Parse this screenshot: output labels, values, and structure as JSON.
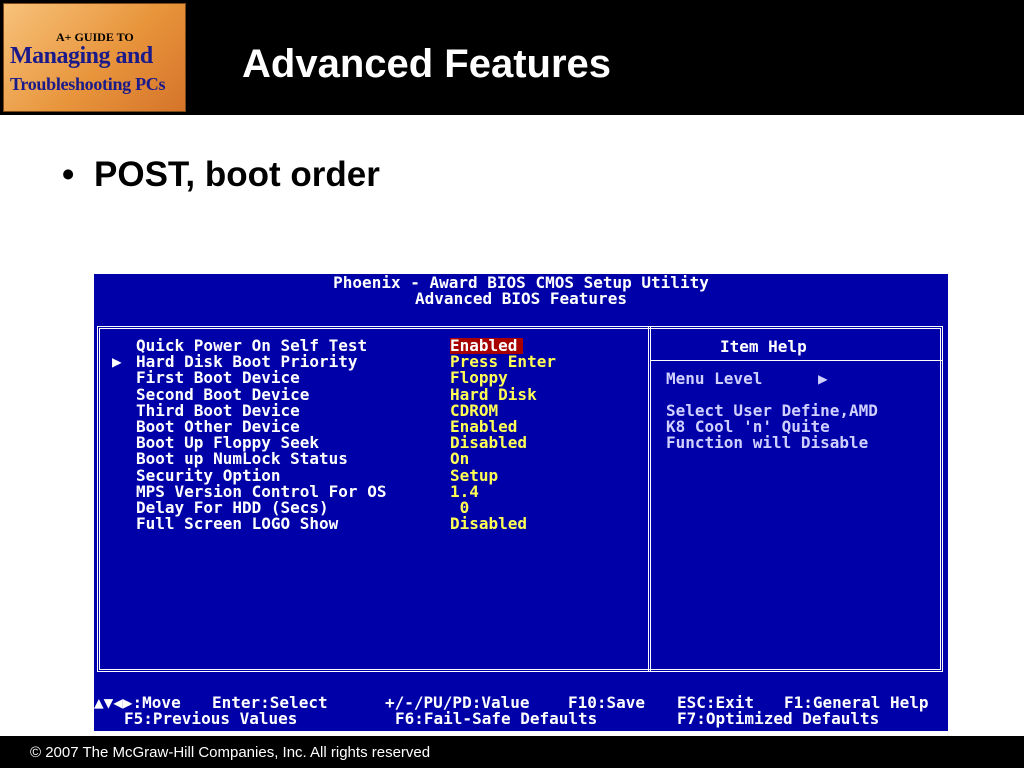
{
  "header": {
    "logo_line1": "A+ GUIDE TO",
    "logo_line2": "Managing and",
    "logo_line3": "Troubleshooting PCs",
    "title": "Advanced Features"
  },
  "bullet": {
    "glyph": "•",
    "text": "POST, boot order"
  },
  "bios": {
    "title_line1": "Phoenix - Award BIOS CMOS Setup Utility",
    "title_line2": "Advanced BIOS Features",
    "items": [
      {
        "label": "Quick Power On Self Test",
        "value": "Enabled",
        "arrow": "",
        "selected": true
      },
      {
        "label": "Hard Disk Boot Priority",
        "value": "Press Enter",
        "arrow": "▶",
        "selected": false
      },
      {
        "label": "First Boot Device",
        "value": "Floppy",
        "arrow": "",
        "selected": false
      },
      {
        "label": "Second Boot Device",
        "value": "Hard Disk",
        "arrow": "",
        "selected": false
      },
      {
        "label": "Third Boot Device",
        "value": "CDROM",
        "arrow": "",
        "selected": false
      },
      {
        "label": "Boot Other Device",
        "value": "Enabled",
        "arrow": "",
        "selected": false
      },
      {
        "label": "Boot Up Floppy Seek",
        "value": "Disabled",
        "arrow": "",
        "selected": false
      },
      {
        "label": "Boot up NumLock Status",
        "value": "On",
        "arrow": "",
        "selected": false
      },
      {
        "label": "Security Option",
        "value": "Setup",
        "arrow": "",
        "selected": false
      },
      {
        "label": "MPS Version Control For OS",
        "value": "1.4",
        "arrow": "",
        "selected": false
      },
      {
        "label": "Delay For HDD (Secs)",
        "value": " 0",
        "arrow": "",
        "selected": false
      },
      {
        "label": "Full Screen LOGO Show",
        "value": "Disabled",
        "arrow": "",
        "selected": false
      }
    ],
    "help": {
      "title": "Item Help",
      "menu_level": "Menu Level",
      "menu_level_arrow": "▶",
      "lines": [
        "Select User Define,AMD",
        "K8 Cool 'n' Quite",
        "Function will Disable"
      ]
    },
    "footer": {
      "move": "▲▼◀▶:Move",
      "select": "Enter:Select",
      "values": "+/-/PU/PD:Value",
      "save": "F10:Save",
      "exit": "ESC:Exit",
      "help": "F1:General Help",
      "prev": "F5:Previous Values",
      "failsafe": "F6:Fail-Safe Defaults",
      "optimized": "F7:Optimized Defaults"
    },
    "colors": {
      "background": "#0000a8",
      "label": "#ffffff",
      "value": "#ffff54",
      "selection": "#a80000"
    }
  },
  "copyright": "© 2007 The McGraw-Hill Companies, Inc. All rights reserved"
}
